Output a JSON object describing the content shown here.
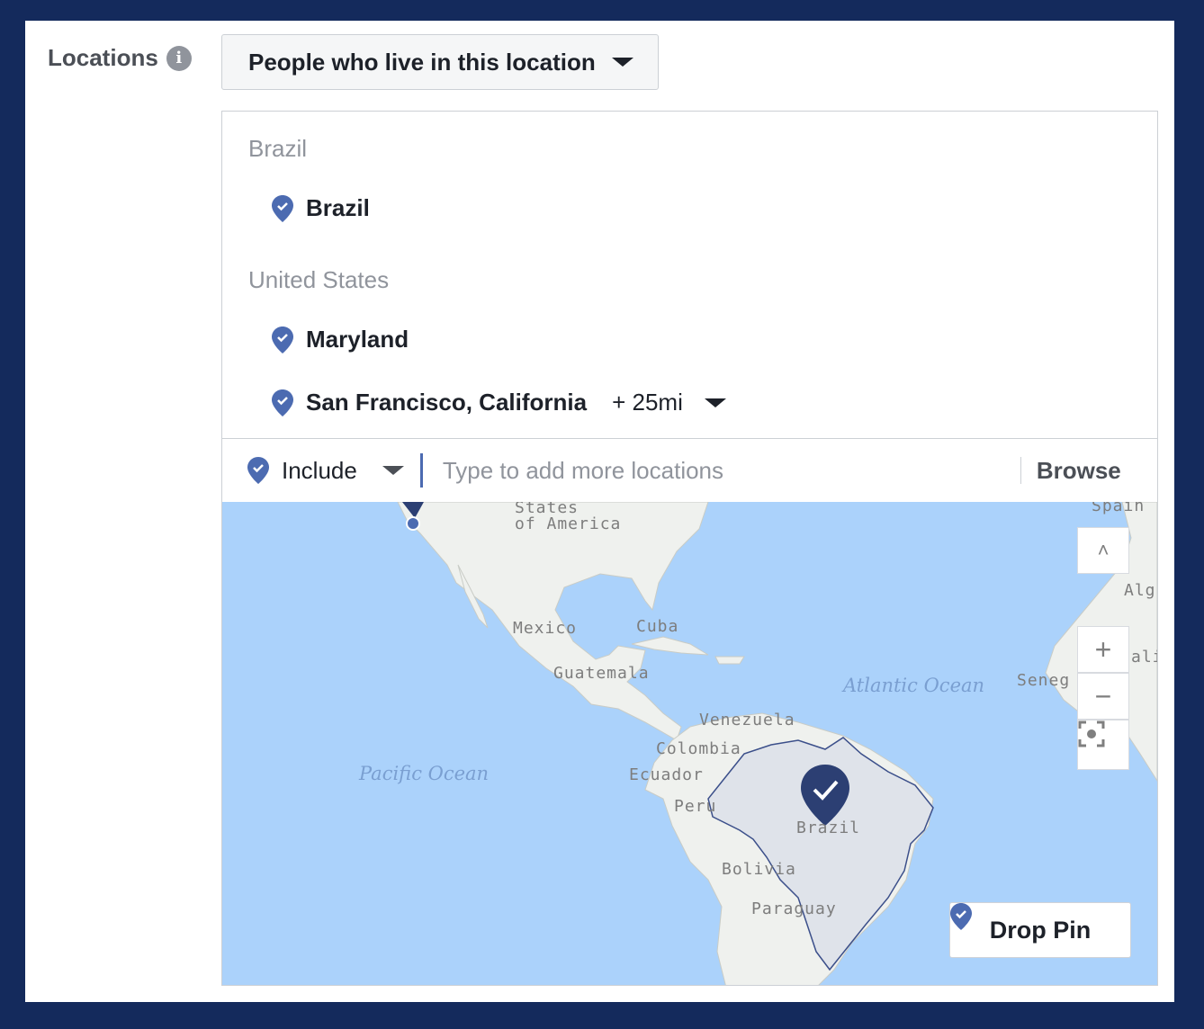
{
  "locations": {
    "label": "Locations",
    "info_icon": "info-icon",
    "audience_type": "People who live in this location",
    "groups": [
      {
        "country": "Brazil",
        "items": [
          {
            "name": "Brazil"
          }
        ]
      },
      {
        "country": "United States",
        "items": [
          {
            "name": "Maryland"
          },
          {
            "name": "San Francisco, California",
            "radius": "+ 25mi"
          }
        ]
      }
    ],
    "include_label": "Include",
    "search_placeholder": "Type to add more locations",
    "browse_label": "Browse"
  },
  "map": {
    "labels": {
      "usa": "States\nof America",
      "mexico": "Mexico",
      "cuba": "Cuba",
      "guatemala": "Guatemala",
      "venezuela": "Venezuela",
      "colombia": "Colombia",
      "ecuador": "Ecuador",
      "peru": "Peru",
      "brazil": "Brazil",
      "bolivia": "Bolivia",
      "paraguay": "Paraguay",
      "spain": "Spain",
      "algeria": "Alg",
      "mali": "ali",
      "senegal": "Seneg",
      "pacific": "Pacific Ocean",
      "atlantic": "Atlantic Ocean"
    },
    "controls": {
      "up": "˄",
      "zoom_in": "+",
      "zoom_out": "−",
      "fit": "fit-icon"
    },
    "drop_pin_label": "Drop Pin"
  },
  "colors": {
    "accent": "#4267b2",
    "pin": "#4c6bb1",
    "background": "#142a5c"
  }
}
